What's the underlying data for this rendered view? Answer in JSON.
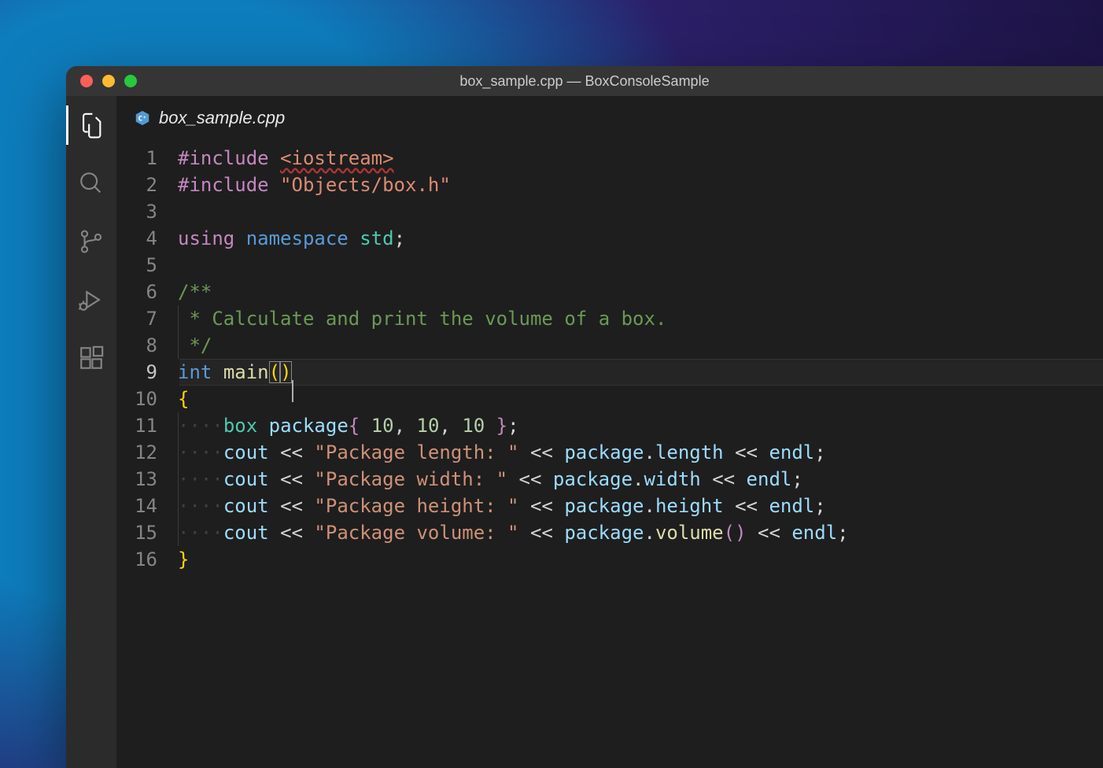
{
  "window_title": "box_sample.cpp — BoxConsoleSample",
  "tab": {
    "label": "box_sample.cpp",
    "language_badge": "C⁺"
  },
  "activitybar": {
    "items": [
      {
        "name": "explorer-icon",
        "active": true
      },
      {
        "name": "search-icon",
        "active": false
      },
      {
        "name": "scm-icon",
        "active": false
      },
      {
        "name": "run-debug-icon",
        "active": false
      },
      {
        "name": "extensions-icon",
        "active": false
      }
    ]
  },
  "current_line": 9,
  "code_lines": [
    {
      "n": 1,
      "tokens": [
        {
          "t": "#include",
          "c": "directive"
        },
        {
          "t": " ",
          "c": "ws"
        },
        {
          "t": "<iostream>",
          "c": "include",
          "underline_error": true
        }
      ]
    },
    {
      "n": 2,
      "tokens": [
        {
          "t": "#include",
          "c": "directive"
        },
        {
          "t": " ",
          "c": "ws"
        },
        {
          "t": "\"Objects/box.h\"",
          "c": "include"
        }
      ]
    },
    {
      "n": 3,
      "tokens": []
    },
    {
      "n": 4,
      "tokens": [
        {
          "t": "using",
          "c": "keyword"
        },
        {
          "t": " ",
          "c": "ws"
        },
        {
          "t": "namespace",
          "c": "keyword2"
        },
        {
          "t": " ",
          "c": "ws"
        },
        {
          "t": "std",
          "c": "type"
        },
        {
          "t": ";",
          "c": "punct"
        }
      ]
    },
    {
      "n": 5,
      "tokens": []
    },
    {
      "n": 6,
      "tokens": [
        {
          "t": "/**",
          "c": "comment"
        }
      ]
    },
    {
      "n": 7,
      "tokens": [
        {
          "t": " ",
          "c": "ws",
          "guide": true
        },
        {
          "t": "*",
          "c": "comment"
        },
        {
          "t": " ",
          "c": "ws"
        },
        {
          "t": "Calculate",
          "c": "comment"
        },
        {
          "t": " ",
          "c": "ws"
        },
        {
          "t": "and",
          "c": "comment"
        },
        {
          "t": " ",
          "c": "ws"
        },
        {
          "t": "print",
          "c": "comment"
        },
        {
          "t": " ",
          "c": "ws"
        },
        {
          "t": "the",
          "c": "comment"
        },
        {
          "t": " ",
          "c": "ws"
        },
        {
          "t": "volume",
          "c": "comment"
        },
        {
          "t": " ",
          "c": "ws"
        },
        {
          "t": "of",
          "c": "comment"
        },
        {
          "t": " ",
          "c": "ws"
        },
        {
          "t": "a",
          "c": "comment"
        },
        {
          "t": " ",
          "c": "ws"
        },
        {
          "t": "box.",
          "c": "comment"
        }
      ]
    },
    {
      "n": 8,
      "tokens": [
        {
          "t": " ",
          "c": "ws",
          "guide": true
        },
        {
          "t": "*/",
          "c": "comment"
        }
      ]
    },
    {
      "n": 9,
      "tokens": [
        {
          "t": "int",
          "c": "keyword2"
        },
        {
          "t": " ",
          "c": "ws"
        },
        {
          "t": "main",
          "c": "func"
        },
        {
          "t": "(",
          "c": "brace",
          "boxed": true
        },
        {
          "t": ")",
          "c": "brace",
          "boxed": true
        },
        {
          "cursor": true
        }
      ]
    },
    {
      "n": 10,
      "tokens": [
        {
          "t": "{",
          "c": "brace"
        }
      ]
    },
    {
      "n": 11,
      "tokens": [
        {
          "t": "·",
          "c": "ws",
          "guide": true
        },
        {
          "t": "···",
          "c": "ws"
        },
        {
          "t": "box",
          "c": "type"
        },
        {
          "t": " ",
          "c": "ws"
        },
        {
          "t": "package",
          "c": "ident"
        },
        {
          "t": "{",
          "c": "brace2"
        },
        {
          "t": " ",
          "c": "ws"
        },
        {
          "t": "10",
          "c": "number"
        },
        {
          "t": ",",
          "c": "punct"
        },
        {
          "t": " ",
          "c": "ws"
        },
        {
          "t": "10",
          "c": "number"
        },
        {
          "t": ",",
          "c": "punct"
        },
        {
          "t": " ",
          "c": "ws"
        },
        {
          "t": "10",
          "c": "number"
        },
        {
          "t": " ",
          "c": "ws"
        },
        {
          "t": "}",
          "c": "brace2"
        },
        {
          "t": ";",
          "c": "punct"
        }
      ]
    },
    {
      "n": 12,
      "tokens": [
        {
          "t": "·",
          "c": "ws",
          "guide": true
        },
        {
          "t": "···",
          "c": "ws"
        },
        {
          "t": "cout",
          "c": "ident"
        },
        {
          "t": " ",
          "c": "ws"
        },
        {
          "t": "<<",
          "c": "punct"
        },
        {
          "t": " ",
          "c": "ws"
        },
        {
          "t": "\"Package length: \"",
          "c": "string"
        },
        {
          "t": " ",
          "c": "ws"
        },
        {
          "t": "<<",
          "c": "punct"
        },
        {
          "t": " ",
          "c": "ws"
        },
        {
          "t": "package",
          "c": "ident"
        },
        {
          "t": ".",
          "c": "punct"
        },
        {
          "t": "length",
          "c": "ident"
        },
        {
          "t": " ",
          "c": "ws"
        },
        {
          "t": "<<",
          "c": "punct"
        },
        {
          "t": " ",
          "c": "ws"
        },
        {
          "t": "endl",
          "c": "ident"
        },
        {
          "t": ";",
          "c": "punct"
        }
      ]
    },
    {
      "n": 13,
      "tokens": [
        {
          "t": "·",
          "c": "ws",
          "guide": true
        },
        {
          "t": "···",
          "c": "ws"
        },
        {
          "t": "cout",
          "c": "ident"
        },
        {
          "t": " ",
          "c": "ws"
        },
        {
          "t": "<<",
          "c": "punct"
        },
        {
          "t": " ",
          "c": "ws"
        },
        {
          "t": "\"Package width: \"",
          "c": "string"
        },
        {
          "t": " ",
          "c": "ws"
        },
        {
          "t": "<<",
          "c": "punct"
        },
        {
          "t": " ",
          "c": "ws"
        },
        {
          "t": "package",
          "c": "ident"
        },
        {
          "t": ".",
          "c": "punct"
        },
        {
          "t": "width",
          "c": "ident"
        },
        {
          "t": " ",
          "c": "ws"
        },
        {
          "t": "<<",
          "c": "punct"
        },
        {
          "t": " ",
          "c": "ws"
        },
        {
          "t": "endl",
          "c": "ident"
        },
        {
          "t": ";",
          "c": "punct"
        }
      ]
    },
    {
      "n": 14,
      "tokens": [
        {
          "t": "·",
          "c": "ws",
          "guide": true
        },
        {
          "t": "···",
          "c": "ws"
        },
        {
          "t": "cout",
          "c": "ident"
        },
        {
          "t": " ",
          "c": "ws"
        },
        {
          "t": "<<",
          "c": "punct"
        },
        {
          "t": " ",
          "c": "ws"
        },
        {
          "t": "\"Package height: \"",
          "c": "string"
        },
        {
          "t": " ",
          "c": "ws"
        },
        {
          "t": "<<",
          "c": "punct"
        },
        {
          "t": " ",
          "c": "ws"
        },
        {
          "t": "package",
          "c": "ident"
        },
        {
          "t": ".",
          "c": "punct"
        },
        {
          "t": "height",
          "c": "ident"
        },
        {
          "t": " ",
          "c": "ws"
        },
        {
          "t": "<<",
          "c": "punct"
        },
        {
          "t": " ",
          "c": "ws"
        },
        {
          "t": "endl",
          "c": "ident"
        },
        {
          "t": ";",
          "c": "punct"
        }
      ]
    },
    {
      "n": 15,
      "tokens": [
        {
          "t": "·",
          "c": "ws",
          "guide": true
        },
        {
          "t": "···",
          "c": "ws"
        },
        {
          "t": "cout",
          "c": "ident"
        },
        {
          "t": " ",
          "c": "ws"
        },
        {
          "t": "<<",
          "c": "punct"
        },
        {
          "t": " ",
          "c": "ws"
        },
        {
          "t": "\"Package volume: \"",
          "c": "string"
        },
        {
          "t": " ",
          "c": "ws"
        },
        {
          "t": "<<",
          "c": "punct"
        },
        {
          "t": " ",
          "c": "ws"
        },
        {
          "t": "package",
          "c": "ident"
        },
        {
          "t": ".",
          "c": "punct"
        },
        {
          "t": "volume",
          "c": "method"
        },
        {
          "t": "(",
          "c": "brace2"
        },
        {
          "t": ")",
          "c": "brace2"
        },
        {
          "t": " ",
          "c": "ws"
        },
        {
          "t": "<<",
          "c": "punct"
        },
        {
          "t": " ",
          "c": "ws"
        },
        {
          "t": "endl",
          "c": "ident"
        },
        {
          "t": ";",
          "c": "punct"
        }
      ]
    },
    {
      "n": 16,
      "tokens": [
        {
          "t": "}",
          "c": "brace"
        }
      ]
    }
  ]
}
